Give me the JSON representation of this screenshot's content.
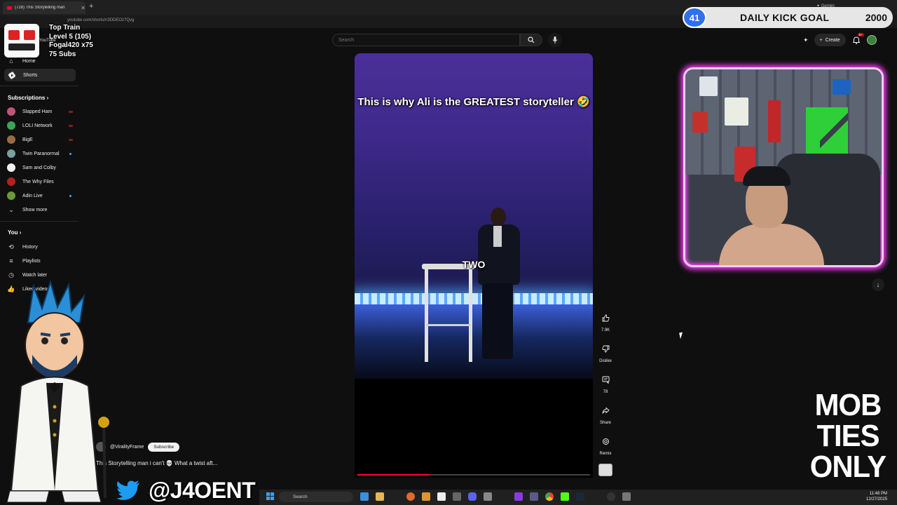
{
  "browser": {
    "tab_title": "(728) This Storytelling man",
    "url": "youtube.com/shorts/n3DDEOz7Qvg",
    "new_tab_glyph": "+",
    "gemini_label": "Gemini"
  },
  "train_widget": {
    "line1": "Top Train",
    "line2": "Level 5  (105)",
    "line3": "Fogal420 x75",
    "line4": "75 Subs"
  },
  "sidebar": {
    "logo_label": "YouTube",
    "home_label": "Home",
    "shorts_label": "Shorts",
    "subscriptions_heading": "Subscriptions",
    "subscriptions": [
      {
        "label": "Slapped Ham",
        "color": "#c0557a",
        "status": "live"
      },
      {
        "label": "LOLI Network",
        "color": "#3aa655",
        "status": "live"
      },
      {
        "label": "BigE",
        "color": "#9b6b43",
        "status": "live"
      },
      {
        "label": "Twin Paranormal",
        "color": "#7aa0a0",
        "status": "new"
      },
      {
        "label": "Sam and Colby",
        "color": "#f1f1f1",
        "status": "none"
      },
      {
        "label": "The Why Files",
        "color": "#b32020",
        "status": "none"
      },
      {
        "label": "Adin Live",
        "color": "#6a9a3a",
        "status": "new"
      }
    ],
    "show_more_label": "Show more",
    "you_heading": "You",
    "you_items": [
      {
        "label": "History",
        "icon": "history-icon"
      },
      {
        "label": "Playlists",
        "icon": "playlists-icon"
      },
      {
        "label": "Watch later",
        "icon": "watch-later-icon"
      },
      {
        "label": "Liked videos",
        "icon": "liked-videos-icon"
      }
    ]
  },
  "search": {
    "placeholder": "Search"
  },
  "header": {
    "create_label": "Create",
    "notif_badge": "9+"
  },
  "kick_goal": {
    "level": "41",
    "label": "DAILY KICK GOAL",
    "target": "2000"
  },
  "short": {
    "caption": "This is why Ali is the GREATEST storyteller 🤣",
    "subtitle_word": "TWO",
    "progress": 0.31,
    "channel": "@ViralityFrame",
    "subscribe_label": "Subscribe",
    "title": "This Storytelling man i can't 💀 What a twist aft..."
  },
  "actions": [
    {
      "name": "like",
      "label": "7.9K"
    },
    {
      "name": "dislike",
      "label": "Dislike"
    },
    {
      "name": "comments",
      "label": "78"
    },
    {
      "name": "share",
      "label": "Share"
    },
    {
      "name": "remix",
      "label": "Remix"
    }
  ],
  "overlay": {
    "twitter_handle": "@J4OENT",
    "mob_ties": [
      "MOB",
      "TIES",
      "ONLY"
    ]
  },
  "taskbar": {
    "search_label": "Search",
    "time": "11:48 PM",
    "date": "12/27/2025"
  },
  "colors": {
    "youtube_red": "#ff0033",
    "kick_green": "#53fc18",
    "neon_pink": "#ff40ff",
    "kick_blue": "#2f6ff0"
  }
}
